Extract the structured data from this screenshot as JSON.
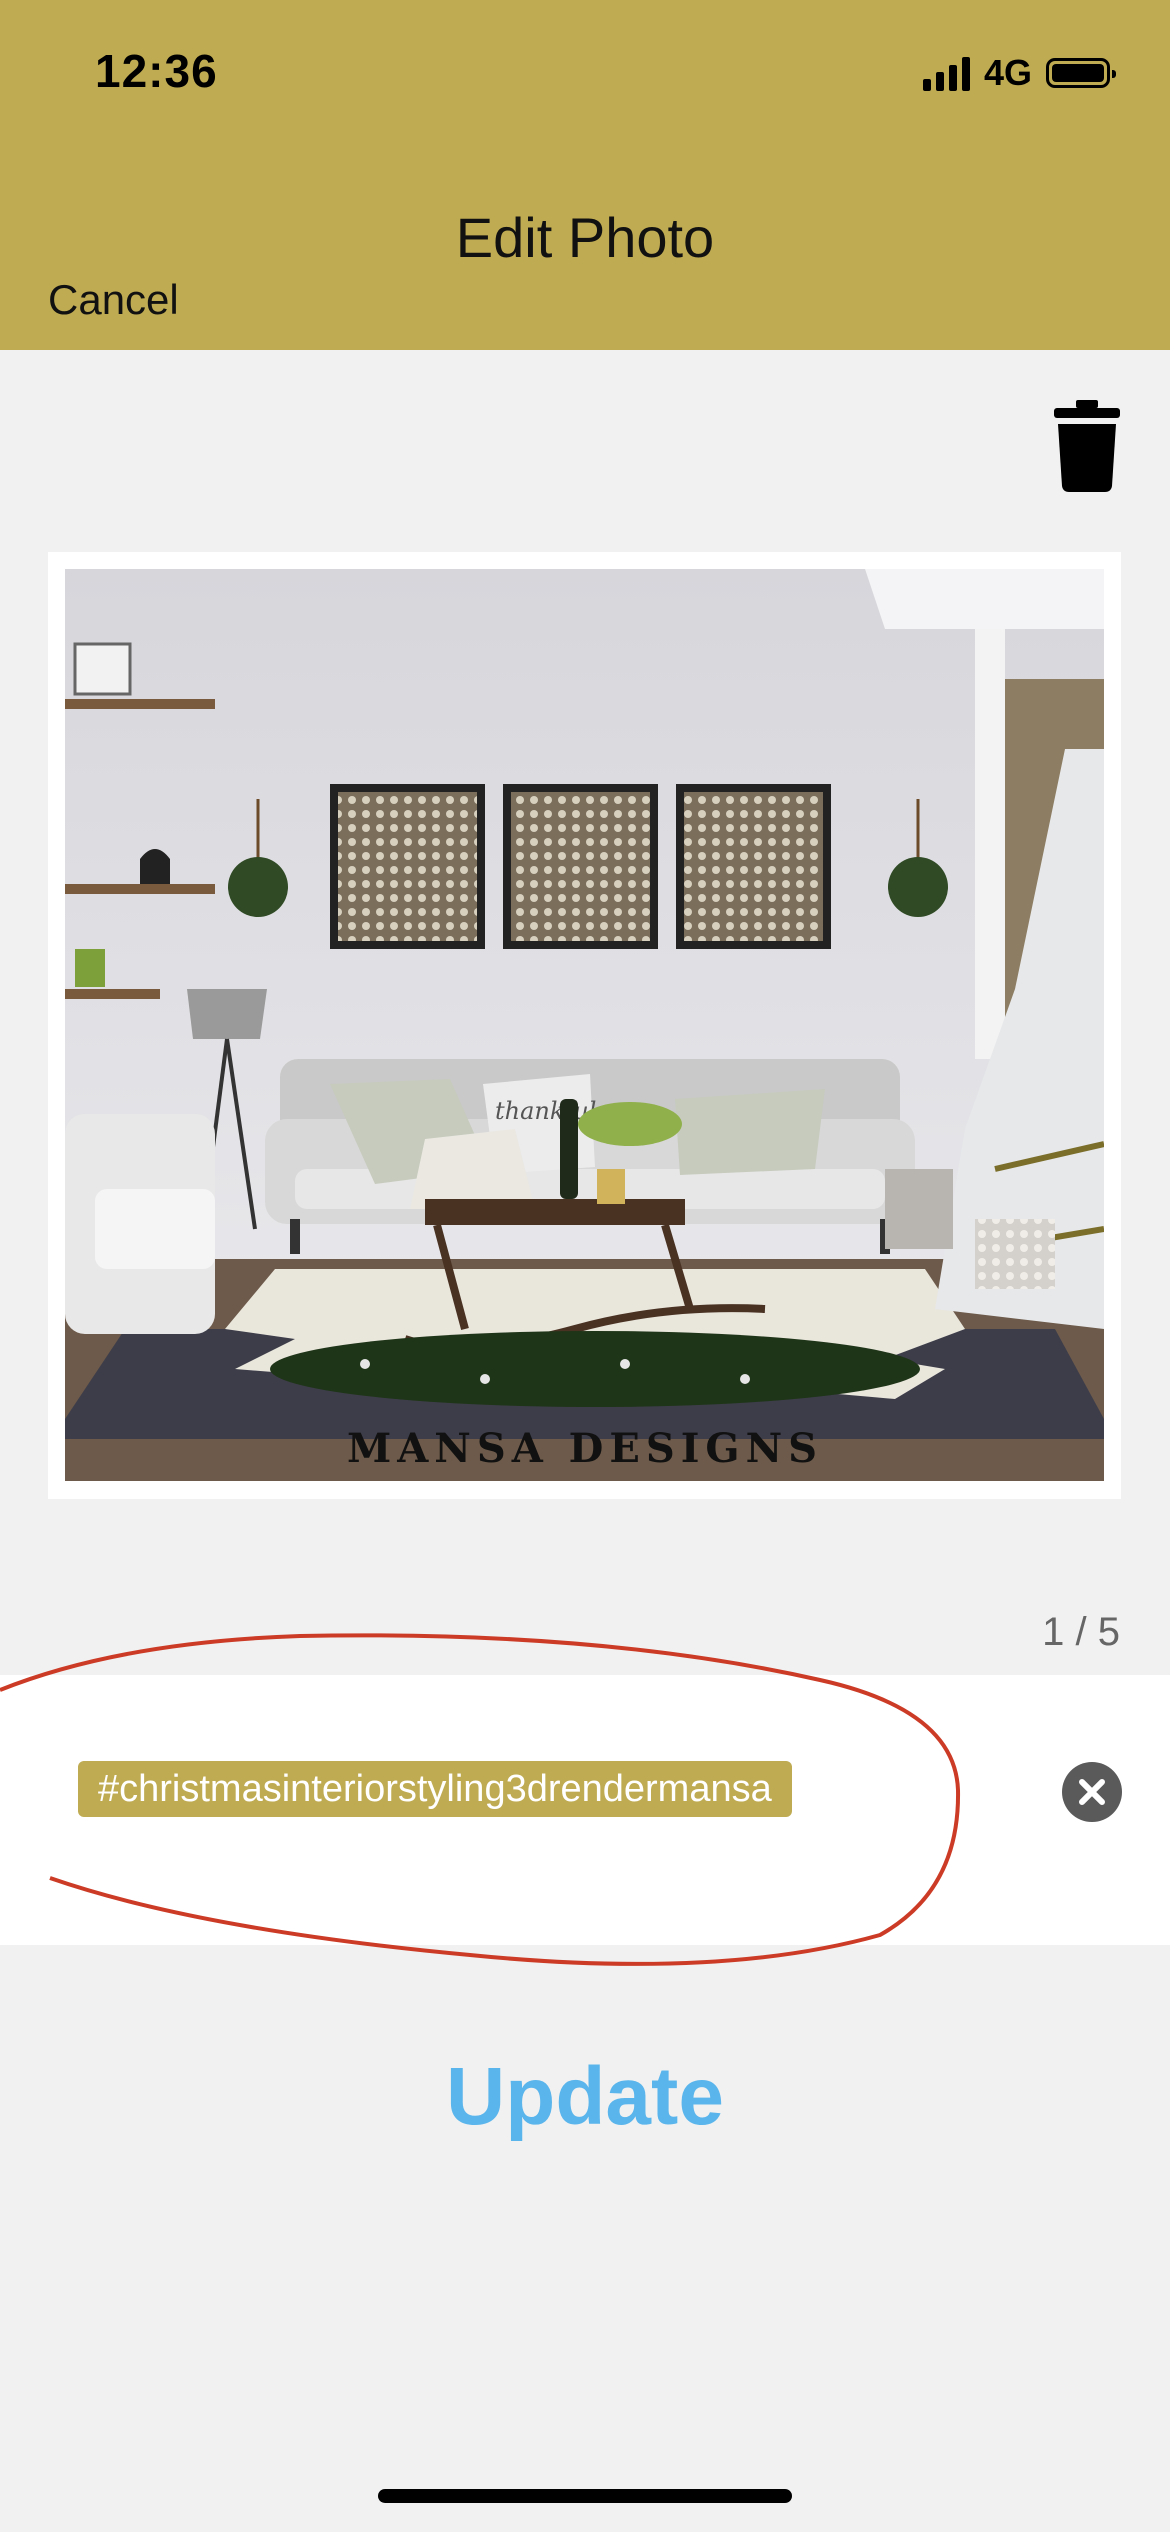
{
  "status_bar": {
    "time": "12:36",
    "network": "4G",
    "battery_level": 0.9
  },
  "header": {
    "title": "Edit Photo",
    "cancel_label": "Cancel"
  },
  "photo": {
    "watermark": "MANSA DESIGNS",
    "pillow_text": "thankful"
  },
  "counter": "1 / 5",
  "tags": [
    "#christmasinteriorstyling3drendermansa"
  ],
  "update_label": "Update",
  "colors": {
    "accent": "#bfab52",
    "link": "#5ab5ec",
    "annotation": "#cc3b26"
  }
}
